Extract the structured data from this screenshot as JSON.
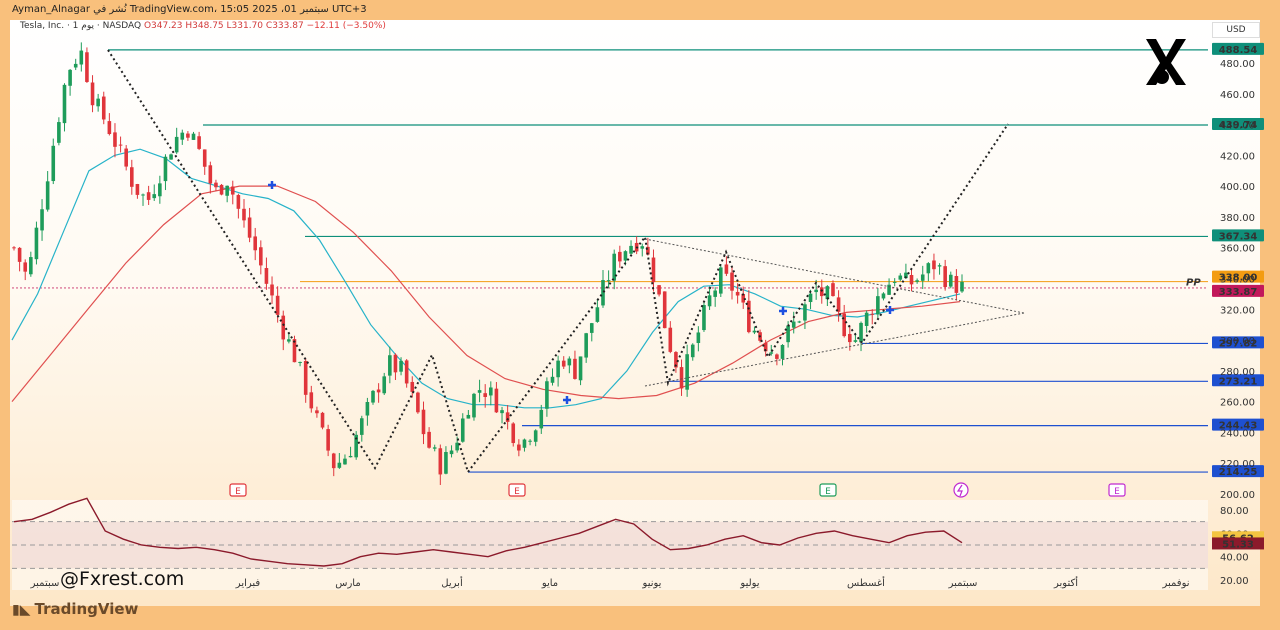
{
  "header": {
    "attribution": "Ayman_Alnagar نُشر في TradingView.com، سبتمبر 01، 2025 15:05 UTC+3"
  },
  "legend": {
    "symbol": "Tesla, Inc. · 1 يوم · NASDAQ",
    "open": "O347.23",
    "high": "H348.75",
    "low": "L331.70",
    "close": "C333.87",
    "change": "−12.11 (−3.50%)"
  },
  "currency": "USD",
  "watermark": "@Fxrest.com",
  "brand": "TradingView",
  "chart_data": {
    "type": "candlestick",
    "y_axis_ticks": [
      480,
      460,
      440,
      420,
      400,
      380,
      360,
      340,
      320,
      300,
      280,
      260,
      240,
      220,
      200
    ],
    "ylim": [
      200,
      500
    ],
    "x_axis_labels": [
      "سبتمبر",
      "فبراير",
      "مارس",
      "أبريل",
      "مايو",
      "يونيو",
      "يوليو",
      "أغسطس",
      "سبتمبر",
      "أكتوبر",
      "نوفمبر"
    ],
    "horizontal_levels": [
      {
        "value": 488.54,
        "label": "488.54",
        "color": "#0f8f7a"
      },
      {
        "value": 439.74,
        "label": "439.74",
        "color": "#0f8f7a"
      },
      {
        "value": 367.34,
        "label": "367.34",
        "color": "#0f8f7a"
      },
      {
        "value": 338.0,
        "label": "338.00",
        "color": "#f39c12"
      },
      {
        "value": 333.87,
        "label": "333.87",
        "color": "#c2185b"
      },
      {
        "value": 297.82,
        "label": "297.82",
        "color": "#1e50d0"
      },
      {
        "value": 273.21,
        "label": "273.21",
        "color": "#1e50d0"
      },
      {
        "value": 244.43,
        "label": "244.43",
        "color": "#1e50d0"
      },
      {
        "value": 214.25,
        "label": "214.25",
        "color": "#1e50d0"
      }
    ],
    "pp_label": "PP",
    "earnings_markers": [
      "E",
      "E",
      "E",
      "E"
    ],
    "price_close_path": [
      360,
      340,
      385,
      430,
      475,
      488,
      455,
      440,
      420,
      400,
      390,
      410,
      430,
      438,
      420,
      395,
      405,
      380,
      360,
      335,
      310,
      290,
      265,
      240,
      218,
      226,
      245,
      265,
      285,
      280,
      258,
      232,
      218,
      232,
      258,
      270,
      262,
      245,
      232,
      245,
      270,
      290,
      280,
      305,
      330,
      352,
      362,
      366,
      340,
      300,
      275,
      298,
      325,
      342,
      332,
      312,
      300,
      292,
      305,
      318,
      332,
      328,
      310,
      300,
      318,
      332,
      342,
      336,
      342,
      350,
      338,
      334
    ],
    "ma_fast": [
      300,
      330,
      370,
      410,
      420,
      424,
      418,
      405,
      400,
      395,
      392,
      384,
      365,
      338,
      310,
      290,
      272,
      262,
      258,
      258,
      256,
      256,
      258,
      262,
      280,
      305,
      325,
      335,
      336,
      330,
      322,
      320,
      316,
      315,
      318,
      322,
      326,
      330
    ],
    "ma_slow": [
      260,
      290,
      320,
      350,
      375,
      395,
      400,
      400,
      390,
      370,
      345,
      315,
      290,
      275,
      268,
      264,
      262,
      264,
      272,
      285,
      300,
      312,
      318,
      320,
      322,
      325
    ],
    "rsi": {
      "axis_ticks": [
        80,
        60,
        40,
        20
      ],
      "upper": 70,
      "lower": 30,
      "value_labels": [
        "56.62",
        "51.33"
      ],
      "values": [
        70,
        72,
        78,
        85,
        90,
        62,
        55,
        50,
        48,
        47,
        48,
        46,
        43,
        38,
        36,
        34,
        33,
        32,
        34,
        40,
        43,
        42,
        44,
        46,
        44,
        42,
        40,
        45,
        48,
        52,
        56,
        60,
        66,
        72,
        68,
        55,
        46,
        47,
        50,
        55,
        58,
        52,
        50,
        56,
        60,
        62,
        58,
        55,
        52,
        58,
        61,
        62,
        52
      ]
    }
  }
}
